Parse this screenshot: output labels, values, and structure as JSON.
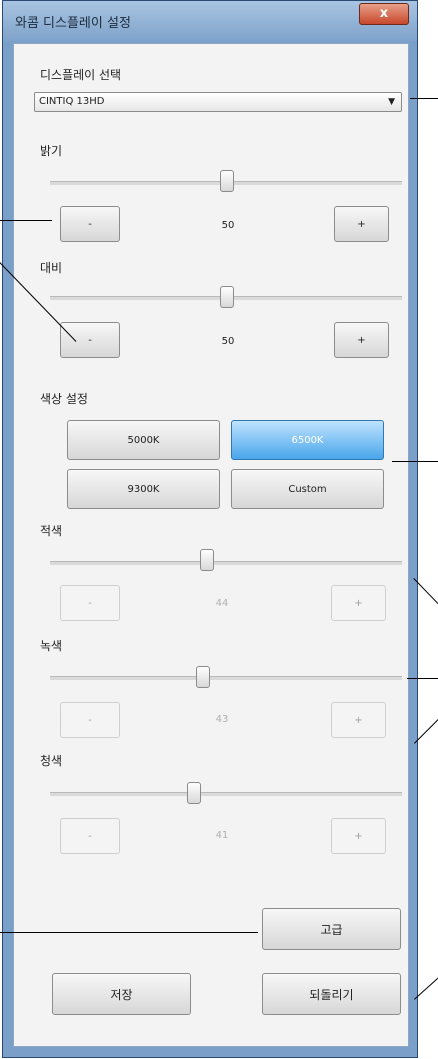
{
  "window": {
    "title": "와콤 디스플레이 설정",
    "close_label": "x"
  },
  "display_select": {
    "label": "디스플레이 선택",
    "value": "CINTIQ 13HD"
  },
  "brightness": {
    "label": "밝기",
    "value": "50",
    "minus": "-",
    "plus": "+"
  },
  "contrast": {
    "label": "대비",
    "value": "50",
    "minus": "-",
    "plus": "+"
  },
  "color_settings": {
    "label": "색상 설정",
    "presets": [
      "5000K",
      "6500K",
      "9300K",
      "Custom"
    ],
    "selected": "6500K"
  },
  "red": {
    "label": "적색",
    "value": "44",
    "minus": "-",
    "plus": "+"
  },
  "green": {
    "label": "녹색",
    "value": "43",
    "minus": "-",
    "plus": "+"
  },
  "blue": {
    "label": "청색",
    "value": "41",
    "minus": "-",
    "plus": "+"
  },
  "buttons": {
    "advanced": "고급",
    "save": "저장",
    "revert": "되돌리기"
  }
}
